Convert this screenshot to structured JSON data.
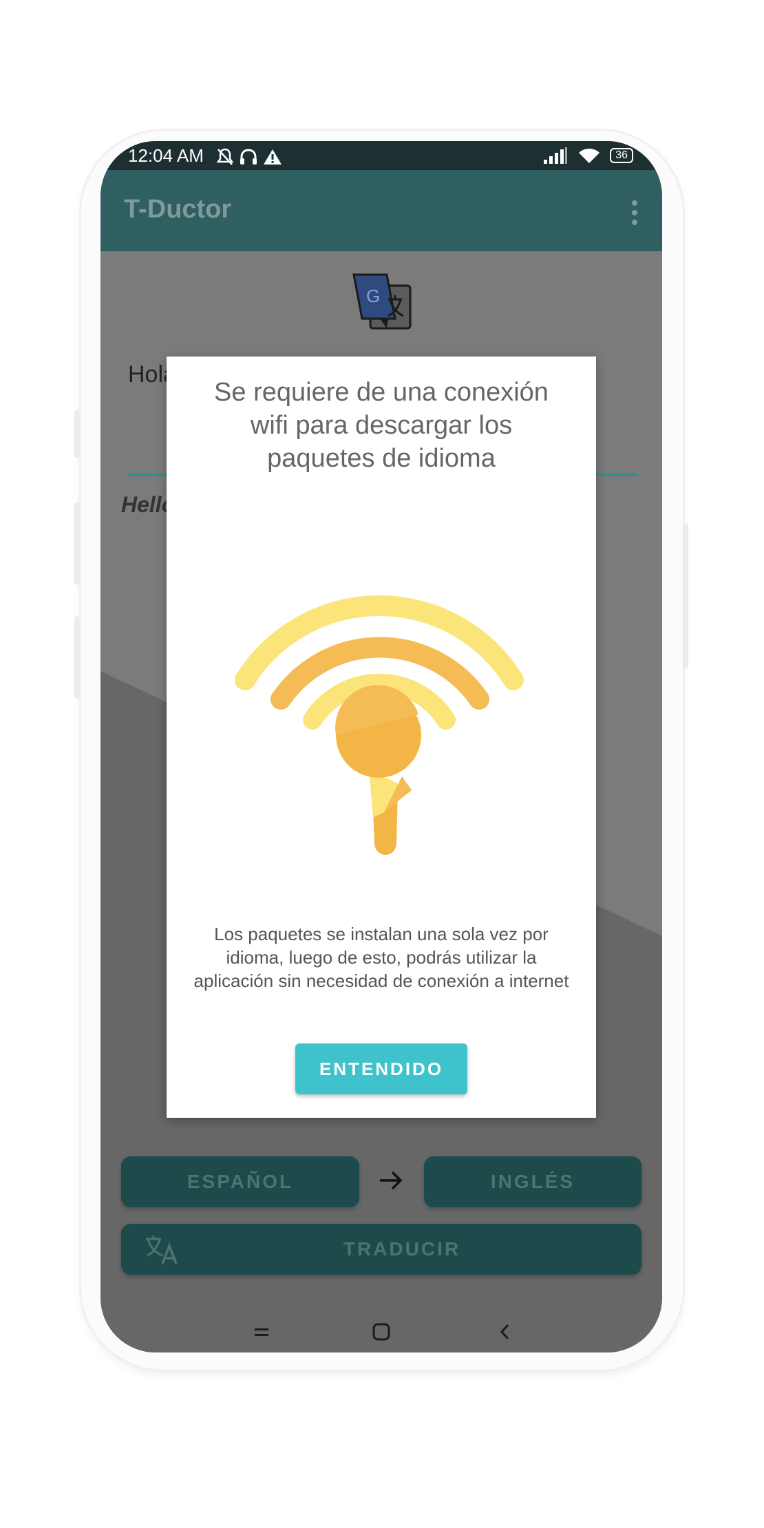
{
  "status_bar": {
    "time": "12:04 AM",
    "battery": "36"
  },
  "app_bar": {
    "title": "T-Ductor"
  },
  "main": {
    "input_text": "Hola",
    "output_text": "Hello"
  },
  "language_bar": {
    "source_language": "ESPAÑOL",
    "target_language": "INGLÉS",
    "translate_button": "TRADUCIR"
  },
  "dialog": {
    "title": "Se requiere de una conexión wifi para descargar los paquetes de idioma",
    "body": "Los paquetes se instalan una sola vez por idioma, luego de esto, podrás utilizar la aplicación sin necesidad de conexión a internet",
    "button_label": "ENTENDIDO"
  },
  "colors": {
    "app_bar": "#2f5f60",
    "accent": "#3ec3cc",
    "button_dark": "#1d4b4b",
    "wifi_yellow_light": "#fbe57a",
    "wifi_yellow_mid": "#f5bb55",
    "wifi_yellow_dark": "#f3b646"
  },
  "icons": [
    "mute-icon",
    "headphones-icon",
    "alert-icon",
    "signal-icon",
    "wifi-icon",
    "battery-icon",
    "more-vert-icon",
    "google-translate-logo",
    "arrow-right-icon",
    "translate-icon",
    "menu-icon",
    "home-icon",
    "back-icon",
    "wifi-illustration"
  ]
}
